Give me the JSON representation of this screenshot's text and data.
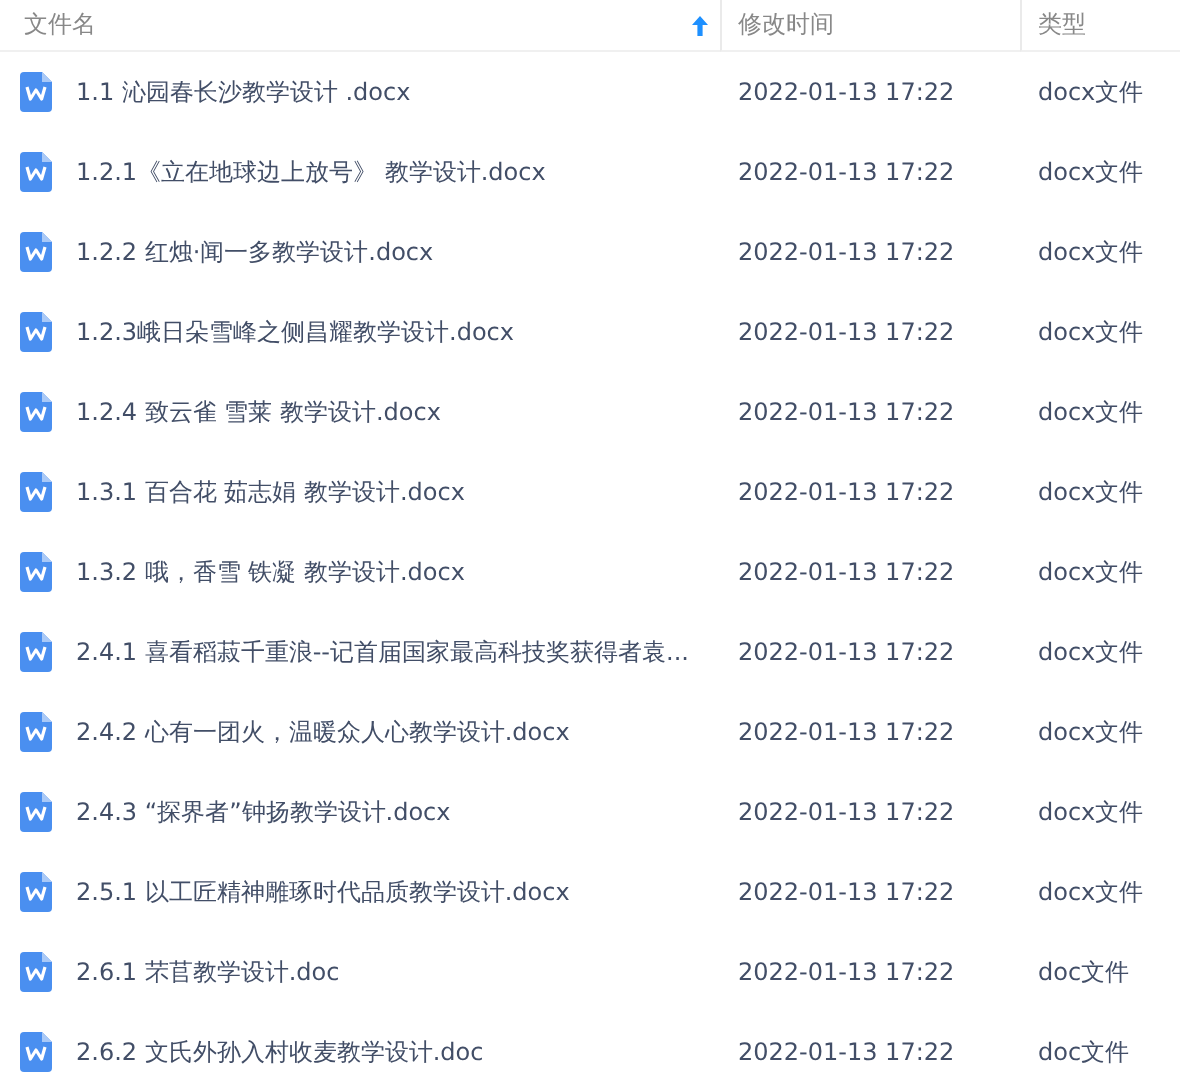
{
  "table": {
    "columns": [
      {
        "label": "文件名",
        "sorted": true
      },
      {
        "label": "修改时间",
        "sorted": false
      },
      {
        "label": "类型",
        "sorted": false
      }
    ],
    "rows": [
      {
        "name": "1.1 沁园春长沙教学设计 .docx",
        "modified": "2022-01-13 17:22",
        "type": "docx文件"
      },
      {
        "name": "1.2.1《立在地球边上放号》 教学设计.docx",
        "modified": "2022-01-13 17:22",
        "type": "docx文件"
      },
      {
        "name": "1.2.2 红烛·闻一多教学设计.docx",
        "modified": "2022-01-13 17:22",
        "type": "docx文件"
      },
      {
        "name": "1.2.3峨日朵雪峰之侧昌耀教学设计.docx",
        "modified": "2022-01-13 17:22",
        "type": "docx文件"
      },
      {
        "name": "1.2.4 致云雀 雪莱 教学设计.docx",
        "modified": "2022-01-13 17:22",
        "type": "docx文件"
      },
      {
        "name": "1.3.1 百合花 茹志娟 教学设计.docx",
        "modified": "2022-01-13 17:22",
        "type": "docx文件"
      },
      {
        "name": "1.3.2 哦，香雪 铁凝 教学设计.docx",
        "modified": "2022-01-13 17:22",
        "type": "docx文件"
      },
      {
        "name": "2.4.1 喜看稻菽千重浪--记首届国家最高科技奖获得者袁...",
        "modified": "2022-01-13 17:22",
        "type": "docx文件"
      },
      {
        "name": "2.4.2 心有一团火，温暖众人心教学设计.docx",
        "modified": "2022-01-13 17:22",
        "type": "docx文件"
      },
      {
        "name": "2.4.3 “探界者”钟扬教学设计.docx",
        "modified": "2022-01-13 17:22",
        "type": "docx文件"
      },
      {
        "name": "2.5.1 以工匠精神雕琢时代品质教学设计.docx",
        "modified": "2022-01-13 17:22",
        "type": "docx文件"
      },
      {
        "name": "2.6.1 芣苢教学设计.doc",
        "modified": "2022-01-13 17:22",
        "type": "doc文件"
      },
      {
        "name": "2.6.2 文氏外孙入村收麦教学设计.doc",
        "modified": "2022-01-13 17:22",
        "type": "doc文件"
      }
    ]
  }
}
